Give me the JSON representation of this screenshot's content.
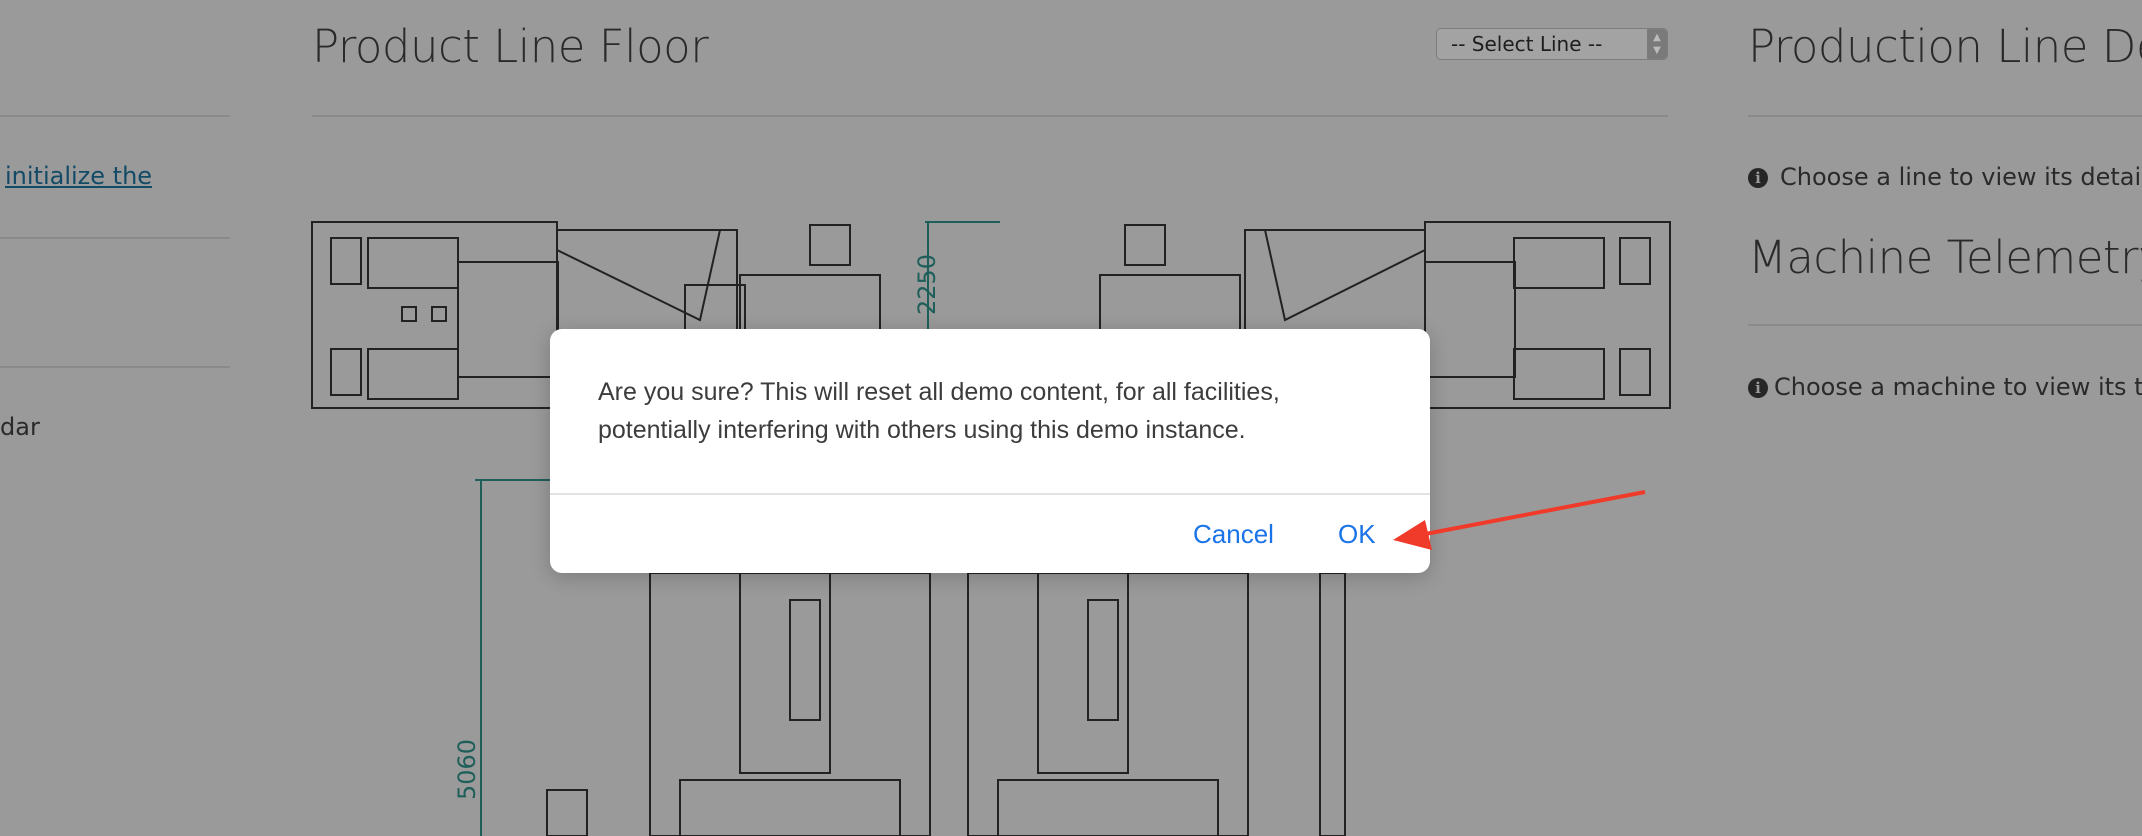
{
  "left_column": {
    "link_text": "initialize the",
    "partial_text": "dar"
  },
  "floor": {
    "title": "Product Line Floor",
    "select_line": "-- Select Line --",
    "dimension_top": "2250",
    "dimension_left": "5060"
  },
  "details": {
    "title": "Production Line Det",
    "line_hint": "Choose a line to view its details",
    "telemetry_title": "Machine Telemetry",
    "machine_hint": "Choose a machine to view its tele"
  },
  "dialog": {
    "message": "Are you sure? This will reset all demo content, for all facilities, potentially interfering with others using this demo instance.",
    "cancel_label": "Cancel",
    "ok_label": "OK"
  },
  "colors": {
    "overlay_background": "#9a9a9a",
    "dialog_button": "#1a73e8",
    "annotation_arrow": "#f03a2a",
    "dimension_line": "#1f5f5a"
  },
  "icons": {
    "info": "info-circle-icon",
    "select_arrows": "chevron-up-down-icon"
  }
}
